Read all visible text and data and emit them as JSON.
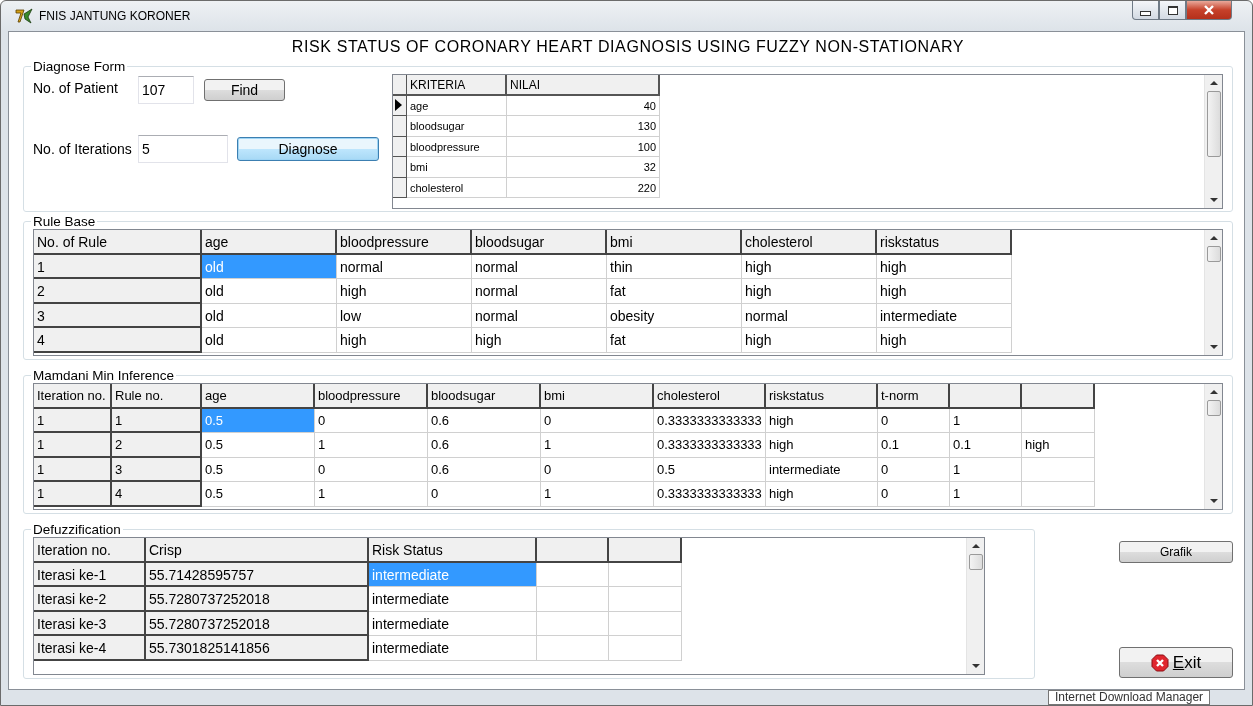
{
  "window": {
    "title": "FNIS JANTUNG KORONER"
  },
  "heading": "RISK STATUS OF CORONARY HEART DIAGNOSIS USING FUZZY NON-STATIONARY",
  "diagnose_form": {
    "title": "Diagnose Form",
    "patient_label": "No. of Patient",
    "patient_value": "107",
    "find_button": "Find",
    "iterations_label": "No. of Iterations",
    "iterations_value": "5",
    "diagnose_button": {
      "label": "Diagnose",
      "focused": true
    },
    "criteria_table": {
      "columns": [
        {
          "label": "KRITERIA",
          "kind": "text"
        },
        {
          "label": "NILAI",
          "kind": "number"
        }
      ],
      "rows": [
        {
          "cells": [
            "age",
            "40"
          ],
          "selected": true
        },
        {
          "cells": [
            "bloodsugar",
            "130"
          ],
          "selected": false
        },
        {
          "cells": [
            "bloodpressure",
            "100"
          ],
          "selected": false
        },
        {
          "cells": [
            "bmi",
            "32"
          ],
          "selected": false
        },
        {
          "cells": [
            "cholesterol",
            "220"
          ],
          "selected": false
        }
      ]
    }
  },
  "sections": [
    {
      "title": "Rule Base",
      "columns": [
        {
          "label": "No. of Rule",
          "kind": "fixed"
        },
        {
          "label": "age",
          "kind": "data"
        },
        {
          "label": "bloodpressure",
          "kind": "data"
        },
        {
          "label": "bloodsugar",
          "kind": "data"
        },
        {
          "label": "bmi",
          "kind": "data"
        },
        {
          "label": "cholesterol",
          "kind": "data"
        },
        {
          "label": "riskstatus",
          "kind": "data"
        }
      ],
      "rows": [
        {
          "cells": [
            "1",
            "old",
            "normal",
            "normal",
            "thin",
            "high",
            "high"
          ],
          "selected": true
        },
        {
          "cells": [
            "2",
            "old",
            "high",
            "normal",
            "fat",
            "high",
            "high"
          ],
          "selected": false
        },
        {
          "cells": [
            "3",
            "old",
            "low",
            "normal",
            "obesity",
            "normal",
            "intermediate"
          ],
          "selected": false
        },
        {
          "cells": [
            "4",
            "old",
            "high",
            "high",
            "fat",
            "high",
            "high"
          ],
          "selected": false
        }
      ]
    },
    {
      "title": "Mamdani Min Inference",
      "columns": [
        {
          "label": "Iteration no.",
          "kind": "fixed"
        },
        {
          "label": "Rule no.",
          "kind": "fixed"
        },
        {
          "label": "age",
          "kind": "data"
        },
        {
          "label": "bloodpressure",
          "kind": "data"
        },
        {
          "label": "bloodsugar",
          "kind": "data"
        },
        {
          "label": "bmi",
          "kind": "data"
        },
        {
          "label": "cholesterol",
          "kind": "data"
        },
        {
          "label": "riskstatus",
          "kind": "data"
        },
        {
          "label": "t-norm",
          "kind": "data"
        },
        {
          "kind": "data"
        },
        {
          "kind": "data"
        }
      ],
      "rows": [
        {
          "cells": [
            "1",
            "1",
            "0.5",
            "0",
            "0.6",
            "0",
            "0.3333333333333",
            "high",
            "0",
            "1",
            null
          ],
          "selected": true
        },
        {
          "cells": [
            "1",
            "2",
            "0.5",
            "1",
            "0.6",
            "1",
            "0.3333333333333",
            "high",
            "0.1",
            "0.1",
            "high"
          ],
          "selected": false
        },
        {
          "cells": [
            "1",
            "3",
            "0.5",
            "0",
            "0.6",
            "0",
            "0.5",
            "intermediate",
            "0",
            "1",
            null
          ],
          "selected": false
        },
        {
          "cells": [
            "1",
            "4",
            "0.5",
            "1",
            "0",
            "1",
            "0.3333333333333",
            "high",
            "0",
            "1",
            null
          ],
          "selected": false
        }
      ]
    },
    {
      "title": "Defuzzification",
      "columns": [
        {
          "label": "Iteration no.",
          "kind": "fixed"
        },
        {
          "label": "Crisp",
          "kind": "fixed"
        },
        {
          "label": "Risk Status",
          "kind": "data"
        },
        {
          "kind": "data"
        },
        {
          "kind": "data"
        }
      ],
      "rows": [
        {
          "cells": [
            "Iterasi ke-1",
            "55.71428595757",
            "intermediate",
            null,
            null
          ],
          "selected": true
        },
        {
          "cells": [
            "Iterasi ke-2",
            "55.7280737252018",
            "intermediate",
            null,
            null
          ],
          "selected": false
        },
        {
          "cells": [
            "Iterasi ke-3",
            "55.7280737252018",
            "intermediate",
            null,
            null
          ],
          "selected": false
        },
        {
          "cells": [
            "Iterasi ke-4",
            "55.7301825141856",
            "intermediate",
            null,
            null
          ],
          "selected": false
        }
      ]
    }
  ],
  "grafik_button": "Grafik",
  "exit_button": "Exit",
  "tooltip": "Internet Download Manager"
}
